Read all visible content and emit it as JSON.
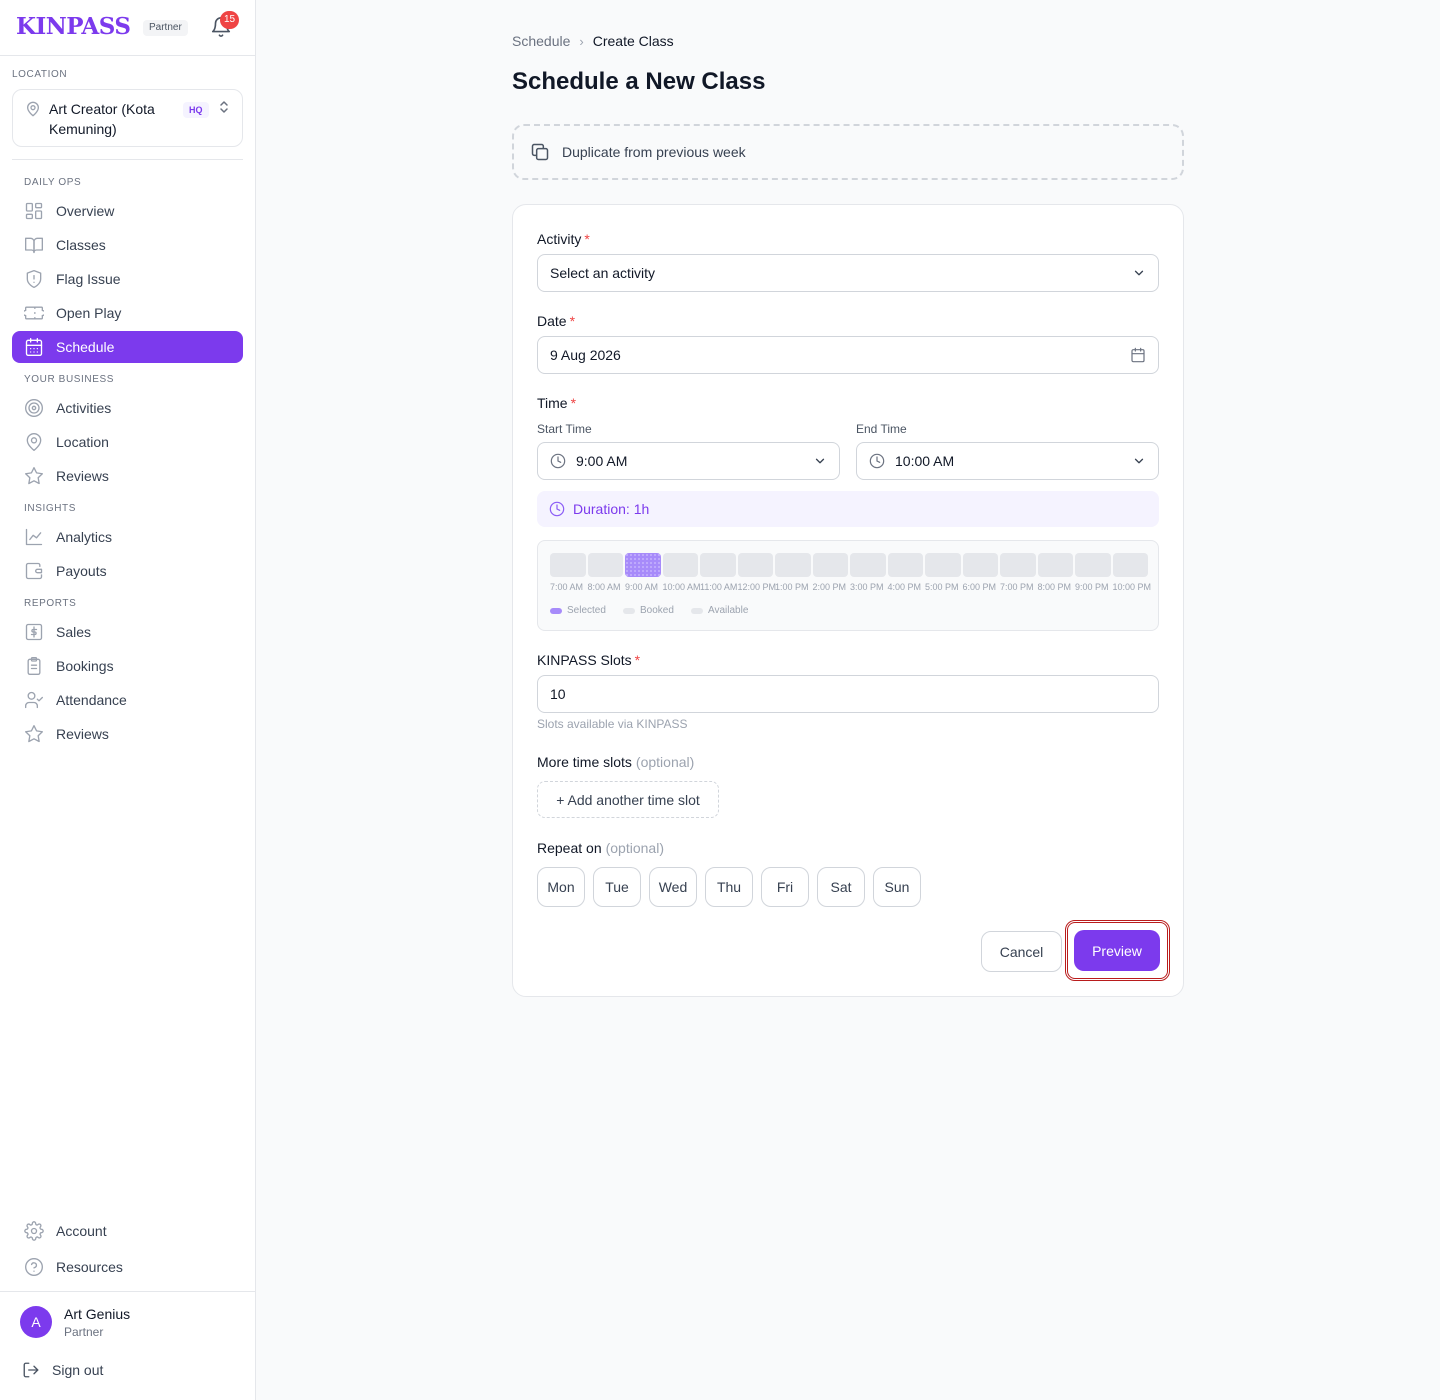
{
  "brand": {
    "logo": "KINPASS",
    "tag": "Partner",
    "notifications": "15"
  },
  "location": {
    "label": "LOCATION",
    "name": "Art Creator (Kota Kemuning)",
    "tag": "HQ"
  },
  "nav": {
    "daily_ops": {
      "label": "DAILY OPS",
      "items": [
        {
          "label": "Overview",
          "icon": "grid-icon"
        },
        {
          "label": "Classes",
          "icon": "book-icon"
        },
        {
          "label": "Flag Issue",
          "icon": "shield-alert-icon"
        },
        {
          "label": "Open Play",
          "icon": "ticket-icon"
        },
        {
          "label": "Schedule",
          "icon": "calendar-icon",
          "active": true
        }
      ]
    },
    "your_business": {
      "label": "YOUR BUSINESS",
      "items": [
        {
          "label": "Activities",
          "icon": "target-icon"
        },
        {
          "label": "Location",
          "icon": "map-pin-icon"
        },
        {
          "label": "Reviews",
          "icon": "star-icon"
        }
      ]
    },
    "insights": {
      "label": "INSIGHTS",
      "items": [
        {
          "label": "Analytics",
          "icon": "line-chart-icon"
        },
        {
          "label": "Payouts",
          "icon": "wallet-icon"
        }
      ]
    },
    "reports": {
      "label": "REPORTS",
      "items": [
        {
          "label": "Sales",
          "icon": "dollar-icon"
        },
        {
          "label": "Bookings",
          "icon": "clipboard-icon"
        },
        {
          "label": "Attendance",
          "icon": "user-check-icon"
        },
        {
          "label": "Reviews",
          "icon": "star-icon"
        }
      ]
    },
    "footer": {
      "items": [
        {
          "label": "Account",
          "icon": "gear-icon"
        },
        {
          "label": "Resources",
          "icon": "help-circle-icon"
        }
      ]
    }
  },
  "user": {
    "initial": "A",
    "name": "Art Genius",
    "role": "Partner",
    "sign_out": "Sign out"
  },
  "breadcrumb": {
    "parent": "Schedule",
    "separator": "›",
    "current": "Create Class"
  },
  "page": {
    "title": "Schedule a New Class",
    "duplicate_label": "Duplicate from previous week"
  },
  "form": {
    "activity": {
      "label": "Activity",
      "required": "*",
      "placeholder": "Select an activity"
    },
    "date": {
      "label": "Date",
      "required": "*",
      "value": "9 Aug 2026"
    },
    "time": {
      "label": "Time",
      "required": "*",
      "start_label": "Start Time",
      "start_value": "9:00 AM",
      "end_label": "End Time",
      "end_value": "10:00 AM",
      "duration": "Duration: 1h"
    },
    "timeline": {
      "slots": [
        "7:00 AM",
        "8:00 AM",
        "9:00 AM",
        "10:00 AM",
        "11:00 AM",
        "12:00 PM",
        "1:00 PM",
        "2:00 PM",
        "3:00 PM",
        "4:00 PM",
        "5:00 PM",
        "6:00 PM",
        "7:00 PM",
        "8:00 PM",
        "9:00 PM",
        "10:00 PM"
      ],
      "selected_index": 2,
      "legend": {
        "selected": "Selected",
        "booked": "Booked",
        "available": "Available"
      }
    },
    "slots": {
      "label": "KINPASS Slots",
      "required": "*",
      "value": "10",
      "hint": "Slots available via KINPASS"
    },
    "more_slots": {
      "label": "More time slots",
      "optional": "(optional)",
      "add_button": "+ Add another time slot"
    },
    "repeat": {
      "label": "Repeat on",
      "optional": "(optional)",
      "days": [
        "Mon",
        "Tue",
        "Wed",
        "Thu",
        "Fri",
        "Sat",
        "Sun"
      ]
    },
    "actions": {
      "cancel": "Cancel",
      "preview": "Preview"
    }
  },
  "colors": {
    "accent": "#7c3aed",
    "required": "#ef4444",
    "highlight": "#b91c1c"
  }
}
